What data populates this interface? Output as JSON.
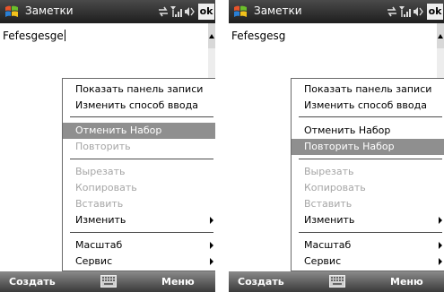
{
  "screens": [
    {
      "app_title": "Заметки",
      "document_text": "Fefesgesge",
      "menu": {
        "show_input_panel": "Показать панель записи",
        "change_input_method": "Изменить способ ввода",
        "undo": "Отменить Набор",
        "redo": "Повторить",
        "cut": "Вырезать",
        "copy": "Копировать",
        "paste": "Вставить",
        "edit": "Изменить",
        "zoom": "Масштаб",
        "tools": "Сервис"
      },
      "softkeys": {
        "left": "Создать",
        "right": "Меню"
      },
      "ok_label": "ok",
      "highlighted_item": "undo"
    },
    {
      "app_title": "Заметки",
      "document_text": "Fefesgesg",
      "menu": {
        "show_input_panel": "Показать панель записи",
        "change_input_method": "Изменить способ ввода",
        "undo": "Отменить Набор",
        "redo": "Повторить Набор",
        "cut": "Вырезать",
        "copy": "Копировать",
        "paste": "Вставить",
        "edit": "Изменить",
        "zoom": "Масштаб",
        "tools": "Сервис"
      },
      "softkeys": {
        "left": "Создать",
        "right": "Меню"
      },
      "ok_label": "ok",
      "highlighted_item": "redo"
    }
  ],
  "colors": {
    "titlebar": "#2b2b2b",
    "menu_highlight": "#8f8f8f",
    "disabled_text": "#a6a6a6",
    "softkey_bar": "#5a5a5a"
  },
  "icons": [
    "windows-start-icon",
    "connectivity-icon",
    "signal-icon",
    "volume-icon",
    "keyboard-icon"
  ]
}
